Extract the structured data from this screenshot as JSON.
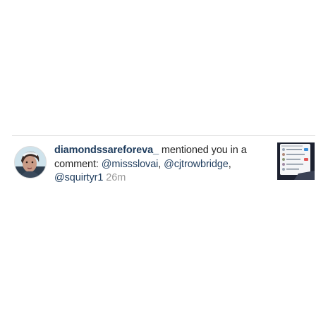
{
  "notification": {
    "username": "diamondssareforeva_",
    "action": " mentioned you in a comment: ",
    "mentions": [
      "@missslovai",
      "@cjtrowbridge",
      "@squirtyr1"
    ],
    "separator": ", ",
    "time": "26m",
    "avatar_icon": "profile-photo",
    "thumbnail_icon": "post-thumbnail"
  },
  "colors": {
    "link": "#1f3d5e",
    "text": "#262626",
    "time": "#9a9a9a",
    "divider": "#d9d9d9"
  }
}
